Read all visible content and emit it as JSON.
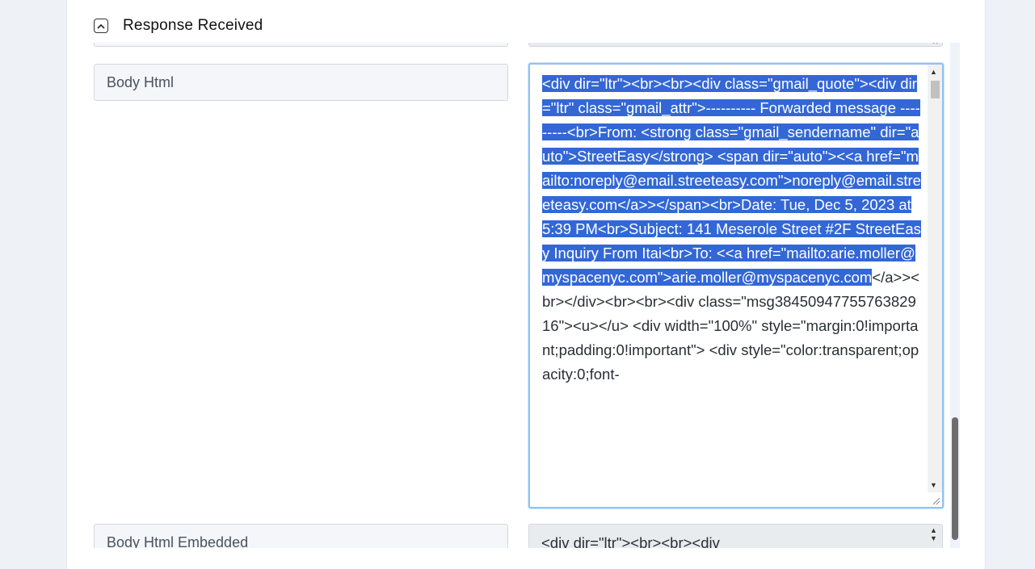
{
  "section": {
    "title": "Response Received",
    "collapse_icon": "chevron-up-icon"
  },
  "fields": [
    {
      "label": "Body Html"
    },
    {
      "label": "Body Html Embedded"
    }
  ],
  "body_html": {
    "selected_text": "<div dir=\"ltr\"><br><br><div class=\"gmail_quote\"><div dir=\"ltr\" class=\"gmail_attr\">---------- Forwarded message ---------<br>From: <strong class=\"gmail_sendername\" dir=\"auto\">StreetEasy</strong> <span dir=\"auto\"><<a href=\"mailto:noreply@email.streeteasy.com\">noreply@email.streeteasy.com</a>></span><br>Date: Tue, Dec 5, 2023 at 5:39 PM<br>Subject: 141 Meserole Street #2F StreetEasy Inquiry From Itai<br>To: <<a href=\"mailto:arie.moller@myspacenyc.com\">arie.moller@myspacenyc.com",
    "rest_text": "</a>><br></div><br><br><div class=\"msg3845094775576382916\"><u></u> <div width=\"100%\" style=\"margin:0!important;padding:0!important\"> <div style=\"color:transparent;opacity:0;font-"
  },
  "body_html_embedded": {
    "value": "<div dir=\"ltr\"><br><br><div"
  },
  "colors": {
    "selection": "#3367d6",
    "focus_border": "#8fc3f2"
  }
}
